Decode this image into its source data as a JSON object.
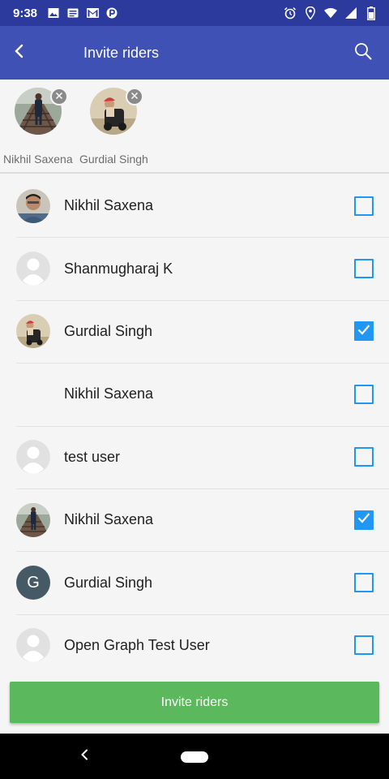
{
  "status_bar": {
    "time": "9:38",
    "left_icons": [
      "image-icon",
      "news-icon",
      "gmail-icon",
      "paytm-icon"
    ],
    "right_icons": [
      "alarm-icon",
      "location-icon",
      "wifi-icon",
      "signal-icon",
      "battery-icon"
    ]
  },
  "app_bar": {
    "title": "Invite riders",
    "back_icon": "back-arrow-icon",
    "search_icon": "search-icon",
    "background": "#3f51b5"
  },
  "selected": [
    {
      "name": "Nikhil Saxena",
      "avatar": "photo-rail"
    },
    {
      "name": "Gurdial Singh",
      "avatar": "photo-turban"
    }
  ],
  "riders": [
    {
      "name": "Nikhil Saxena",
      "avatar": "photo-portrait",
      "checked": false
    },
    {
      "name": "Shanmugharaj K",
      "avatar": "default",
      "checked": false
    },
    {
      "name": "Gurdial Singh",
      "avatar": "photo-turban",
      "checked": true
    },
    {
      "name": "Nikhil Saxena",
      "avatar": "none",
      "checked": false
    },
    {
      "name": "test user",
      "avatar": "default",
      "checked": false
    },
    {
      "name": "Nikhil Saxena",
      "avatar": "photo-rail",
      "checked": true
    },
    {
      "name": "Gurdial Singh",
      "avatar": "letter",
      "letter": "G",
      "checked": false
    },
    {
      "name": "Open Graph Test User",
      "avatar": "default",
      "checked": false
    }
  ],
  "invite_button": {
    "label": "Invite riders",
    "color": "#5cb85c"
  },
  "colors": {
    "checkbox": "#2196f3",
    "status_bar": "#2b3a9c"
  }
}
